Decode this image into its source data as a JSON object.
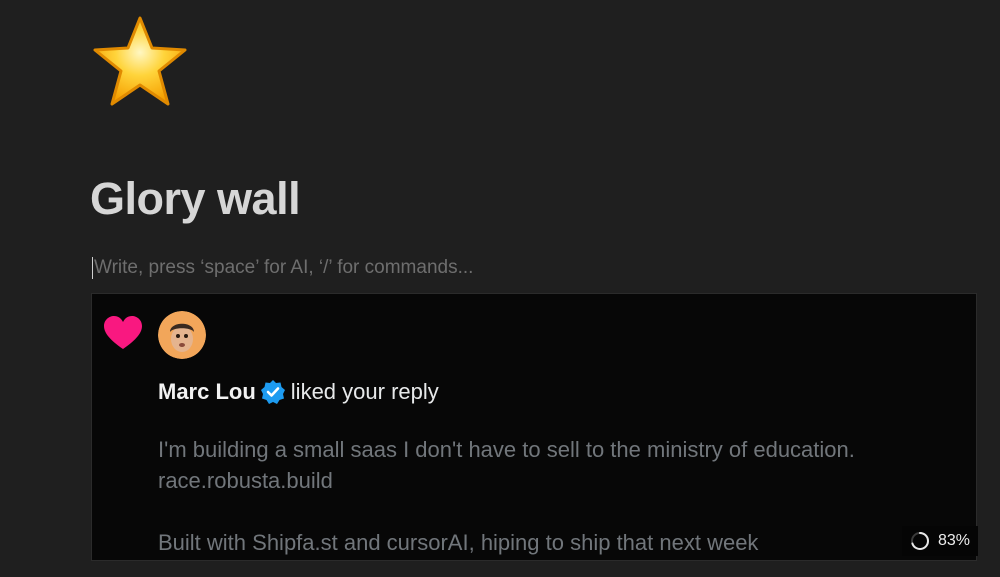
{
  "page": {
    "icon": "star-emoji",
    "title": "Glory wall"
  },
  "editor": {
    "placeholder": "Write, press ‘space’ for AI, ‘/’ for commands..."
  },
  "notification": {
    "reaction_icon": "heart-icon",
    "avatar_icon": "user-avatar",
    "user_name": "Marc Lou",
    "verified_icon": "verified-badge-icon",
    "action_text": "liked your reply",
    "reply_lines": [
      "I'm building a small saas I don't have to sell to the ministry of education.",
      "race.robusta.build",
      "",
      "Built with Shipfa.st and cursorAI, hiping to ship that next week"
    ]
  },
  "status": {
    "progress_icon": "loading-spinner-icon",
    "zoom_label": "83%"
  },
  "colors": {
    "background": "#1f1f1f",
    "embed_background": "#070707",
    "heart": "#f91880",
    "verified": "#1d9bf0",
    "title_text": "#d6d6d6",
    "muted_text": "#71767b"
  }
}
